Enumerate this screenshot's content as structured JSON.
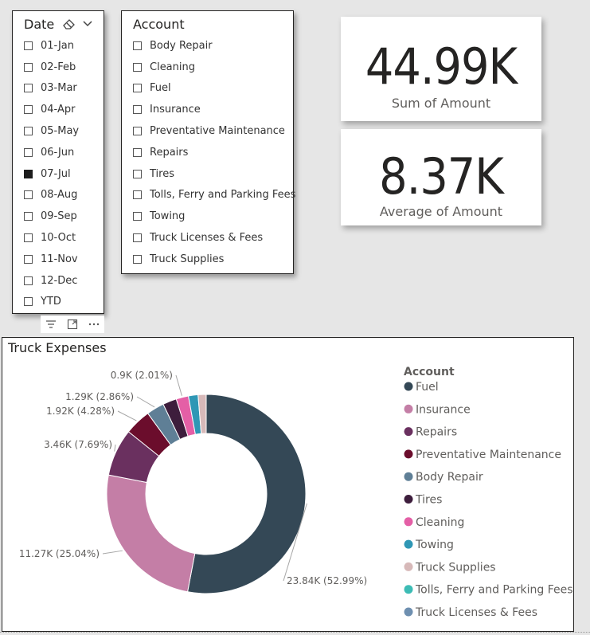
{
  "date_slicer": {
    "title": "Date",
    "items": [
      {
        "label": "01-Jan",
        "checked": false
      },
      {
        "label": "02-Feb",
        "checked": false
      },
      {
        "label": "03-Mar",
        "checked": false
      },
      {
        "label": "04-Apr",
        "checked": false
      },
      {
        "label": "05-May",
        "checked": false
      },
      {
        "label": "06-Jun",
        "checked": false
      },
      {
        "label": "07-Jul",
        "checked": true
      },
      {
        "label": "08-Aug",
        "checked": false
      },
      {
        "label": "09-Sep",
        "checked": false
      },
      {
        "label": "10-Oct",
        "checked": false
      },
      {
        "label": "11-Nov",
        "checked": false
      },
      {
        "label": "12-Dec",
        "checked": false
      },
      {
        "label": "YTD",
        "checked": false
      }
    ],
    "icons": [
      "eraser-icon",
      "chevron-down-icon"
    ]
  },
  "account_slicer": {
    "title": "Account",
    "items": [
      {
        "label": "Body Repair",
        "checked": false
      },
      {
        "label": "Cleaning",
        "checked": false
      },
      {
        "label": "Fuel",
        "checked": false
      },
      {
        "label": "Insurance",
        "checked": false
      },
      {
        "label": "Preventative Maintenance",
        "checked": false
      },
      {
        "label": "Repairs",
        "checked": false
      },
      {
        "label": "Tires",
        "checked": false
      },
      {
        "label": "Tolls, Ferry and Parking Fees",
        "checked": false
      },
      {
        "label": "Towing",
        "checked": false
      },
      {
        "label": "Truck Licenses & Fees",
        "checked": false
      },
      {
        "label": "Truck Supplies",
        "checked": false
      }
    ]
  },
  "visual_toolbar": {
    "icons": [
      "filter-icon",
      "focus-mode-icon",
      "more-options-icon"
    ]
  },
  "kpi_sum": {
    "value": "44.99K",
    "label": "Sum of Amount"
  },
  "kpi_avg": {
    "value": "8.37K",
    "label": "Average of Amount"
  },
  "chart_data": {
    "type": "donut",
    "title": "Truck Expenses",
    "legend_title": "Account",
    "legend_position": "right",
    "slices": [
      {
        "name": "Fuel",
        "value": 23.84,
        "pct": 52.99,
        "label": "23.84K (52.99%)",
        "color": "#344856"
      },
      {
        "name": "Insurance",
        "value": 11.27,
        "pct": 25.04,
        "label": "11.27K (25.04%)",
        "color": "#c47ea6"
      },
      {
        "name": "Repairs",
        "value": 3.46,
        "pct": 7.69,
        "label": "3.46K (7.69%)",
        "color": "#6a305f"
      },
      {
        "name": "Preventative Maintenance",
        "value": 1.92,
        "pct": 4.28,
        "label": "1.92K (4.28%)",
        "color": "#6b0d2c"
      },
      {
        "name": "Body Repair",
        "value": 1.29,
        "pct": 2.86,
        "label": "1.29K (2.86%)",
        "color": "#5f7f96"
      },
      {
        "name": "Tires",
        "value": 1.01,
        "pct": 2.24,
        "label": "",
        "color": "#3d1d3c"
      },
      {
        "name": "Cleaning",
        "value": 0.9,
        "pct": 2.01,
        "label": "0.9K (2.01%)",
        "color": "#e45fa6"
      },
      {
        "name": "Towing",
        "value": 0.7,
        "pct": 1.56,
        "label": "",
        "color": "#2f97b5"
      },
      {
        "name": "Truck Supplies",
        "value": 0.59,
        "pct": 1.31,
        "label": "",
        "color": "#d7b9b9"
      },
      {
        "name": "Tolls, Ferry and Parking Fees",
        "value": 0,
        "pct": 0,
        "label": "",
        "color": "#3dbcb5"
      },
      {
        "name": "Truck Licenses & Fees",
        "value": 0,
        "pct": 0,
        "label": "",
        "color": "#6e8fb0"
      }
    ]
  }
}
